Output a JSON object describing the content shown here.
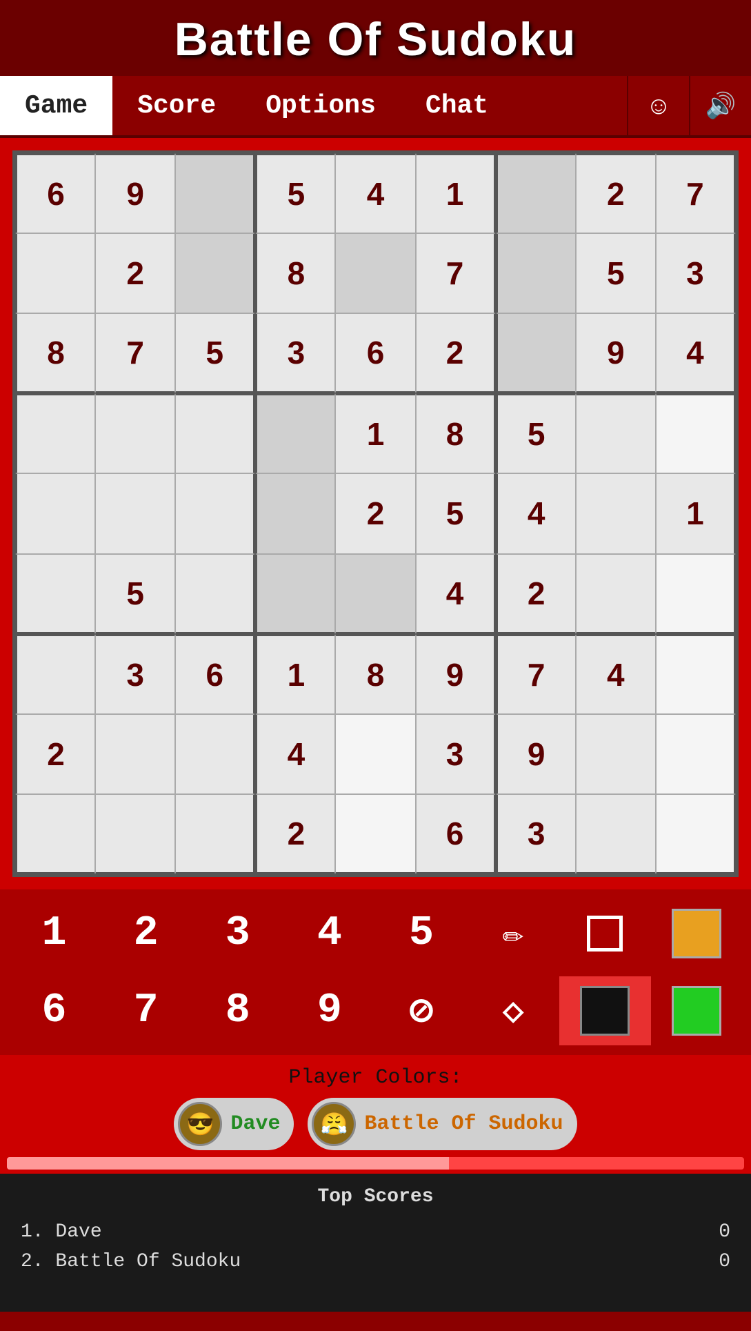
{
  "header": {
    "title": "Battle Of Sudoku"
  },
  "nav": {
    "tabs": [
      {
        "label": "Game",
        "active": true
      },
      {
        "label": "Score",
        "active": false
      },
      {
        "label": "Options",
        "active": false
      },
      {
        "label": "Chat",
        "active": false
      }
    ],
    "emoji_icon": "☺",
    "sound_icon": "🔊"
  },
  "grid": {
    "cells": [
      "6",
      "9",
      "",
      "5",
      "4",
      "1",
      "",
      "2",
      "7",
      "",
      "2",
      "",
      "8",
      "",
      "7",
      "",
      "5",
      "3",
      "8",
      "7",
      "5",
      "3",
      "6",
      "2",
      "",
      "9",
      "4",
      "",
      "",
      "",
      "",
      "1",
      "8",
      "5",
      "",
      "",
      "",
      "",
      "",
      "",
      "2",
      "5",
      "4",
      "",
      "1",
      "",
      "5",
      "",
      "",
      "",
      "4",
      "2",
      "",
      "",
      "",
      "3",
      "6",
      "1",
      "8",
      "9",
      "7",
      "4",
      "",
      "2",
      "",
      "",
      "4",
      "",
      "3",
      "9",
      "",
      "",
      "",
      "",
      "",
      "2",
      "",
      "6",
      "3",
      "",
      ""
    ]
  },
  "numpad": {
    "row1": [
      "1",
      "2",
      "3",
      "4",
      "5"
    ],
    "row2": [
      "6",
      "7",
      "8",
      "9"
    ],
    "icons": {
      "pencil": "✏",
      "square": "□",
      "cancel": "⊘",
      "fill": "◇"
    }
  },
  "player_colors": {
    "label": "Player Colors:",
    "players": [
      {
        "name": "Dave",
        "color": "active",
        "avatar": "😎"
      },
      {
        "name": "Battle Of Sudoku",
        "color": "inactive",
        "avatar": "😤"
      }
    ]
  },
  "top_scores": {
    "title": "Top Scores",
    "scores": [
      {
        "rank": "1.",
        "name": "Dave",
        "score": "0"
      },
      {
        "rank": "2.",
        "name": "Battle Of Sudoku",
        "score": "0"
      }
    ]
  }
}
